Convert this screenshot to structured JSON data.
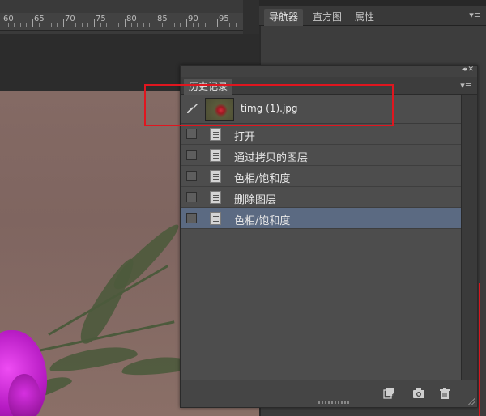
{
  "ruler": {
    "labels": [
      "60",
      "65",
      "70",
      "75",
      "80",
      "85",
      "90",
      "95"
    ]
  },
  "navigator_panel": {
    "tabs": [
      "导航器",
      "直方图",
      "属性"
    ],
    "active_tab": "导航器",
    "menu_icon": "panel-menu-icon"
  },
  "history_panel": {
    "title": "历史记录",
    "collapse_icon": "collapse-icon",
    "close_icon": "close-icon",
    "menu_icon": "panel-menu-icon",
    "snapshot": {
      "label": "timg (1).jpg",
      "brush_icon": "history-brush-icon"
    },
    "steps": [
      {
        "label": "打开",
        "selected": false
      },
      {
        "label": "通过拷贝的图层",
        "selected": false
      },
      {
        "label": "色相/饱和度",
        "selected": false
      },
      {
        "label": "删除图层",
        "selected": false
      },
      {
        "label": "色相/饱和度",
        "selected": true
      }
    ],
    "footer_icons": [
      "new-document-from-state-icon",
      "camera-snapshot-icon",
      "trash-icon"
    ]
  },
  "colors": {
    "highlight": "#e0161f",
    "selected_row": "#5b6a82",
    "panel_bg": "#535353"
  }
}
